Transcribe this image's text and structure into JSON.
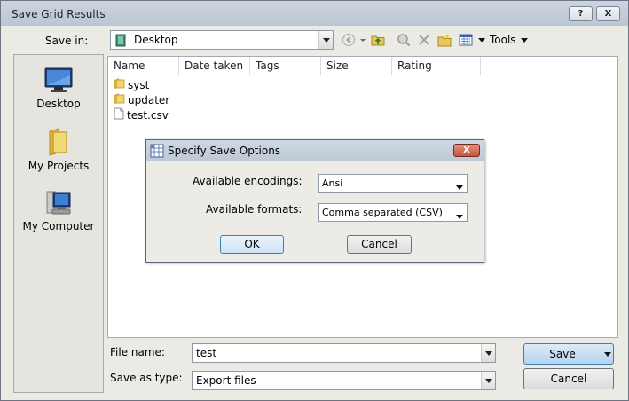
{
  "window": {
    "title": "Save Grid Results",
    "help_label": "?",
    "close_label": "X"
  },
  "toolbar": {
    "save_in_label": "Save in:",
    "save_in_value": "Desktop",
    "tools_label": "Tools"
  },
  "places": [
    {
      "label": "Desktop"
    },
    {
      "label": "My Projects"
    },
    {
      "label": "My Computer"
    }
  ],
  "file_list": {
    "columns": [
      "Name",
      "Date taken",
      "Tags",
      "Size",
      "Rating"
    ],
    "items": [
      {
        "name": "syst",
        "type": "folder"
      },
      {
        "name": "updater",
        "type": "folder"
      },
      {
        "name": "test.csv",
        "type": "file"
      }
    ]
  },
  "bottom": {
    "file_name_label": "File name:",
    "file_name_value": "test",
    "save_as_type_label": "Save as type:",
    "save_as_type_value": "Export files",
    "save_label": "Save",
    "cancel_label": "Cancel"
  },
  "modal": {
    "title": "Specify Save Options",
    "close_label": "X",
    "encodings_label": "Available encodings:",
    "encodings_value": "Ansi",
    "formats_label": "Available formats:",
    "formats_value": "Comma separated (CSV)",
    "ok_label": "OK",
    "cancel_label": "Cancel"
  },
  "colors": {
    "accent_button": "#c6ddf2",
    "titlebar": "#bac6d3",
    "modal_close": "#c65441"
  }
}
